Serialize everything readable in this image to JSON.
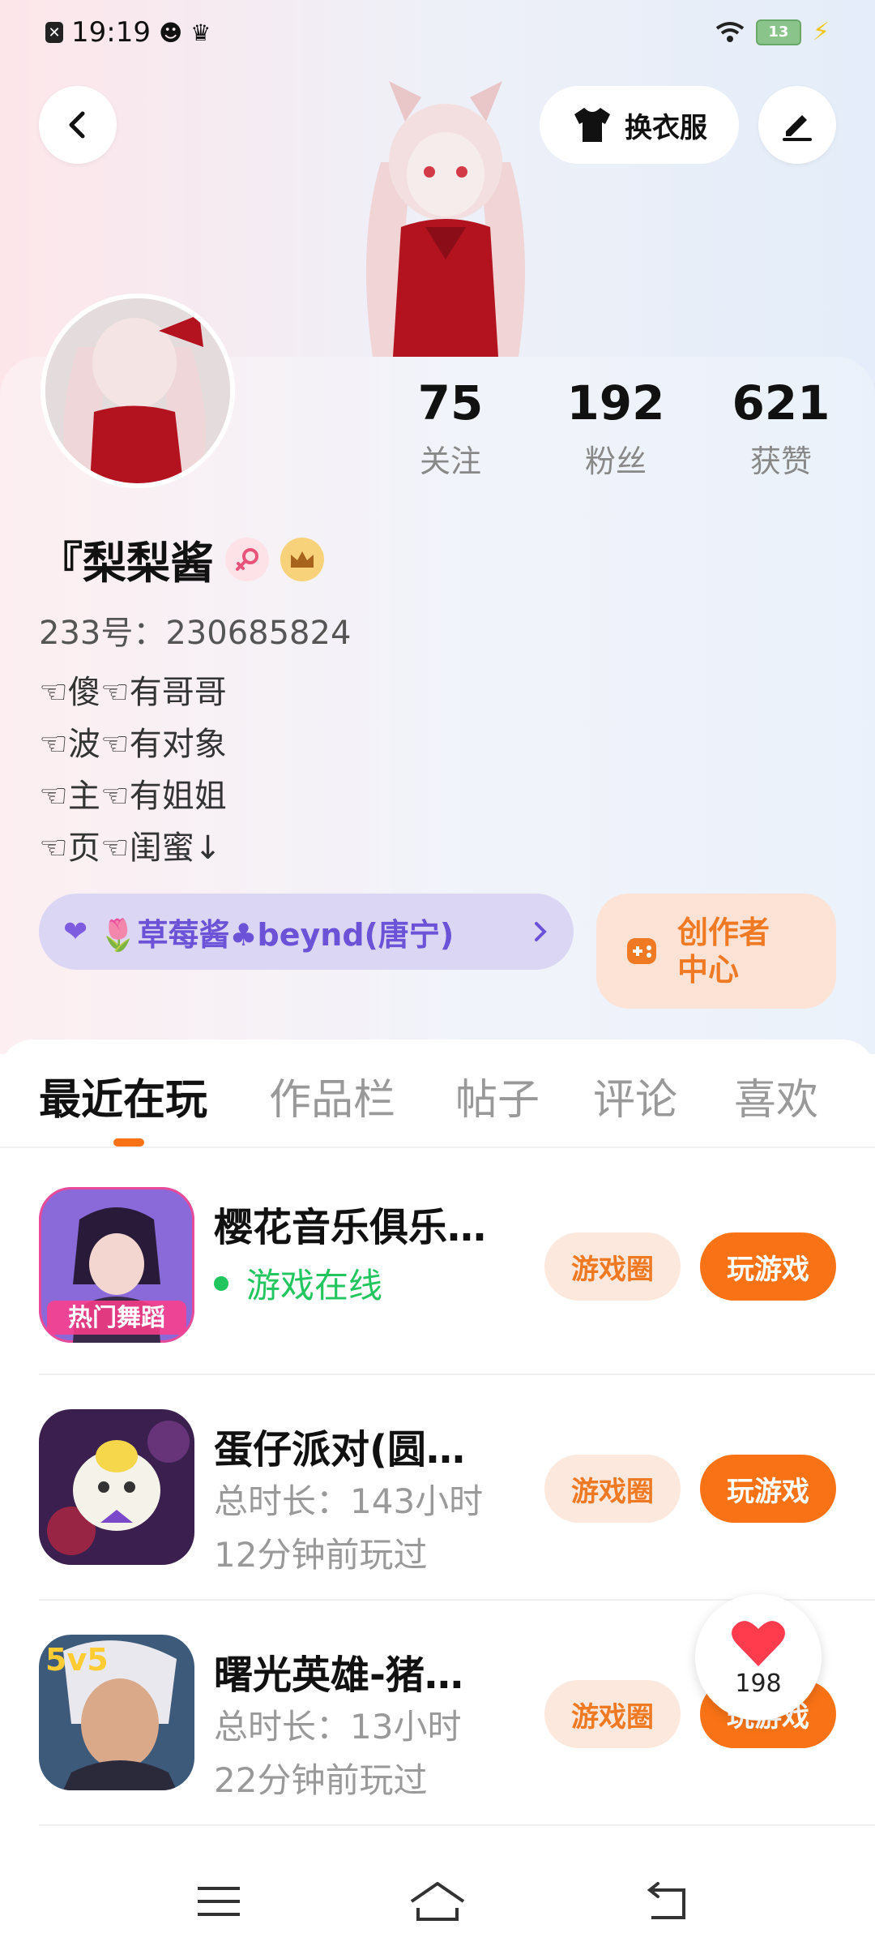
{
  "status_bar": {
    "time": "19:19",
    "battery": "13"
  },
  "header": {
    "dress_label": "换衣服"
  },
  "profile": {
    "name": "『梨梨酱",
    "id_line": "233号：230685824",
    "bio": [
      "☜傻☜有哥哥",
      "☜波☜有对象",
      "☜主☜有姐姐",
      "☜页☜闺蜜↓"
    ],
    "stats": [
      {
        "value": "75",
        "label": "关注"
      },
      {
        "value": "192",
        "label": "粉丝"
      },
      {
        "value": "621",
        "label": "获赞"
      }
    ],
    "relation": "🌷草莓酱♣beynd(唐宁)",
    "creator_label": "创作者中心"
  },
  "tabs": [
    {
      "label": "最近在玩",
      "active": true
    },
    {
      "label": "作品栏",
      "active": false
    },
    {
      "label": "帖子",
      "active": false
    },
    {
      "label": "评论",
      "active": false
    },
    {
      "label": "喜欢",
      "active": false
    }
  ],
  "games": [
    {
      "name": "樱花音乐俱乐…",
      "status": "游戏在线",
      "duration": "",
      "last_played": "",
      "icon_label": "热门舞蹈",
      "circle_label": "游戏圈",
      "play_label": "玩游戏"
    },
    {
      "name": "蛋仔派对(圆…",
      "status": "",
      "duration": "总时长：143小时",
      "last_played": "12分钟前玩过",
      "icon_label": "",
      "circle_label": "游戏圈",
      "play_label": "玩游戏"
    },
    {
      "name": "曙光英雄-猪…",
      "status": "",
      "duration": "总时长：13小时",
      "last_played": "22分钟前玩过",
      "icon_label": "5v5",
      "circle_label": "游戏圈",
      "play_label": "玩游戏"
    }
  ],
  "like_float": {
    "count": "198"
  },
  "colors": {
    "accent": "#f97316",
    "online": "#22c55e",
    "relation_text": "#6b52d6"
  }
}
